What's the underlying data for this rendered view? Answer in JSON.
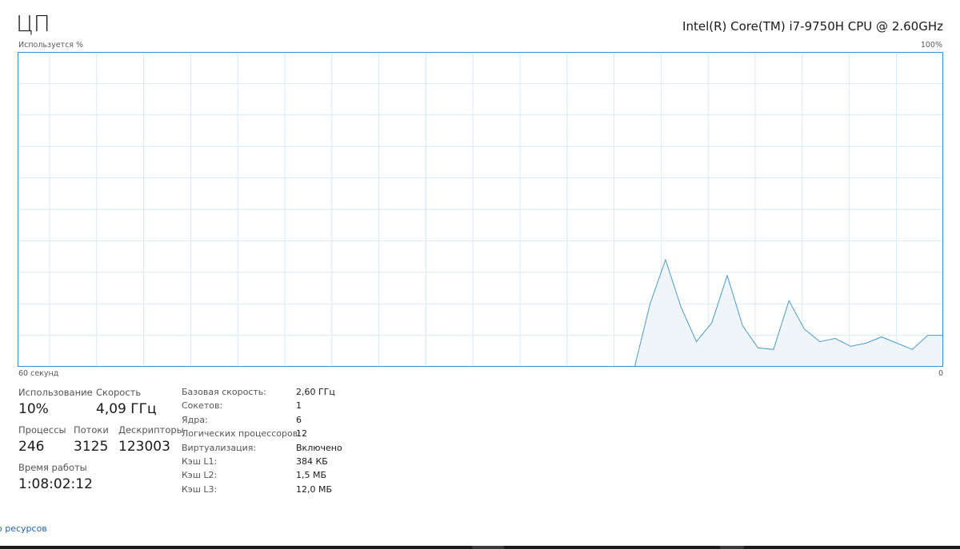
{
  "header": {
    "title": "ЦП",
    "cpu_name": "Intel(R) Core(TM) i7-9750H CPU @ 2.60GHz"
  },
  "graph": {
    "y_label": "Используется %",
    "y_max_label": "100%",
    "x_left_label": "60 секунд",
    "x_right_label": "0",
    "line_color": "#4a9bd1",
    "fill_color": "#f0f5fa",
    "grid_color": "#d9eaf5",
    "border_color": "#3f8fcf"
  },
  "chart_data": {
    "type": "area",
    "x": [
      60,
      40,
      39,
      38,
      37,
      36,
      35,
      34,
      33,
      32,
      31,
      30,
      29,
      28,
      27,
      26,
      25,
      24,
      23,
      22,
      21,
      20,
      19,
      18,
      17,
      16,
      15,
      14,
      13,
      12,
      11,
      10,
      9,
      8,
      7,
      6,
      5,
      4,
      3,
      2,
      1,
      0
    ],
    "values": [
      0,
      0,
      0,
      0,
      0,
      0,
      0,
      0,
      0,
      0,
      0,
      0,
      0,
      0,
      0,
      0,
      0,
      0,
      0,
      0,
      0,
      0,
      20,
      34,
      19,
      8,
      14,
      29,
      13,
      6,
      5.5,
      21,
      12,
      8,
      9,
      6.5,
      7.5,
      9.5,
      7.5,
      5.5,
      10,
      10
    ],
    "xlabel": "60 секунд",
    "ylabel": "Используется %",
    "xlim": [
      60,
      0
    ],
    "ylim": [
      0,
      100
    ],
    "grid": true
  },
  "stats": {
    "usage_label": "Использование",
    "usage_value": "10%",
    "speed_label": "Скорость",
    "speed_value": "4,09 ГГц",
    "processes_label": "Процессы",
    "processes_value": "246",
    "threads_label": "Потоки",
    "threads_value": "3125",
    "handles_label": "Дескрипторы",
    "handles_value": "123003",
    "uptime_label": "Время работы",
    "uptime_value": "1:08:02:12"
  },
  "properties": [
    {
      "key": "Базовая скорость:",
      "value": "2,60 ГГц"
    },
    {
      "key": "Сокетов:",
      "value": "1"
    },
    {
      "key": "Ядра:",
      "value": "6"
    },
    {
      "key": "Логических процессоров:",
      "value": "12"
    },
    {
      "key": "Виртуализация:",
      "value": "Включено"
    },
    {
      "key": "Кэш L1:",
      "value": "384 КБ"
    },
    {
      "key": "Кэш L2:",
      "value": "1,5 МБ"
    },
    {
      "key": "Кэш L3:",
      "value": "12,0 МБ"
    }
  ],
  "footer": {
    "resource_monitor_link": "о ресурсов"
  }
}
